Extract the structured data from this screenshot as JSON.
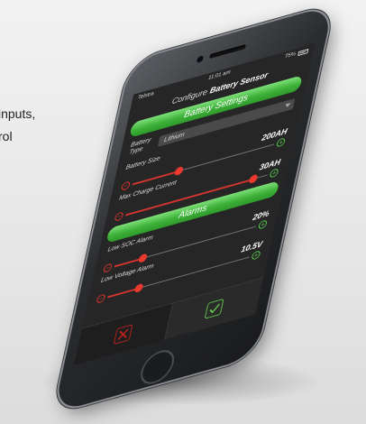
{
  "background": {
    "text_line_1": "inputs,",
    "text_line_2": "rol"
  },
  "status_bar": {
    "carrier": "Telstra",
    "time": "11:01 am",
    "battery": "75%"
  },
  "header": {
    "prefix": "Configure",
    "title": "Battery Sensor"
  },
  "battery_settings": {
    "section_label": "Battery Settings",
    "type": {
      "label_line_1": "Battery",
      "label_line_2": "Type",
      "selected": "Lithium"
    },
    "size": {
      "label": "Battery Size",
      "value": "200AH",
      "level": 0.33
    },
    "max_charge": {
      "label": "Max Charge Current",
      "value": "30AH",
      "level": 0.9
    }
  },
  "alarms": {
    "section_label": "Alarms",
    "low_soc": {
      "label": "Low SOC Alarm",
      "value": "20%",
      "level": 0.2
    },
    "low_voltage": {
      "label": "Low Voltage Alarm",
      "value": "10.5V",
      "level": 0.22
    }
  },
  "tabbar": {
    "cancel_icon": "x-icon",
    "confirm_icon": "check-icon"
  },
  "colors": {
    "accent_green": "#3fb23a",
    "slider_red": "#ea3a30"
  }
}
